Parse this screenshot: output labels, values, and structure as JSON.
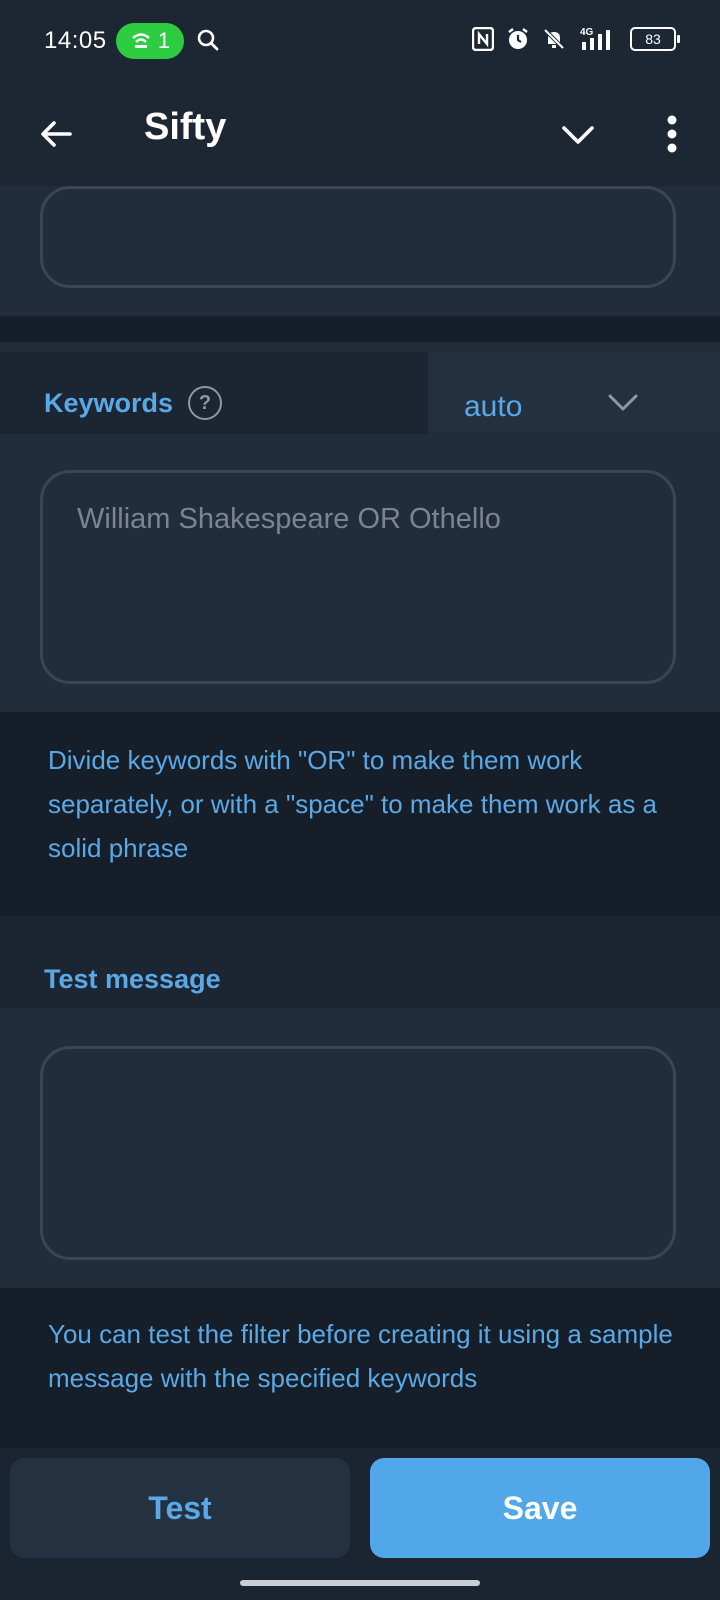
{
  "status_bar": {
    "time": "14:05",
    "hotspot_count": "1",
    "battery": "83"
  },
  "app_bar": {
    "title": "Sifty"
  },
  "keywords": {
    "label": "Keywords",
    "help_symbol": "?",
    "mode_value": "auto",
    "placeholder": "William Shakespeare OR Othello",
    "hint": "Divide keywords with \"OR\" to make them work separately, or with a \"space\" to make them work as a solid phrase"
  },
  "test_message": {
    "label": "Test message",
    "hint": "You can test the filter before creating it using a sample message with the specified keywords"
  },
  "actions": {
    "test_label": "Test",
    "save_label": "Save"
  },
  "colors": {
    "accent": "#5aa9e6",
    "primary_button": "#51a7e7",
    "background": "#1a2531",
    "panel": "#212d3a"
  }
}
